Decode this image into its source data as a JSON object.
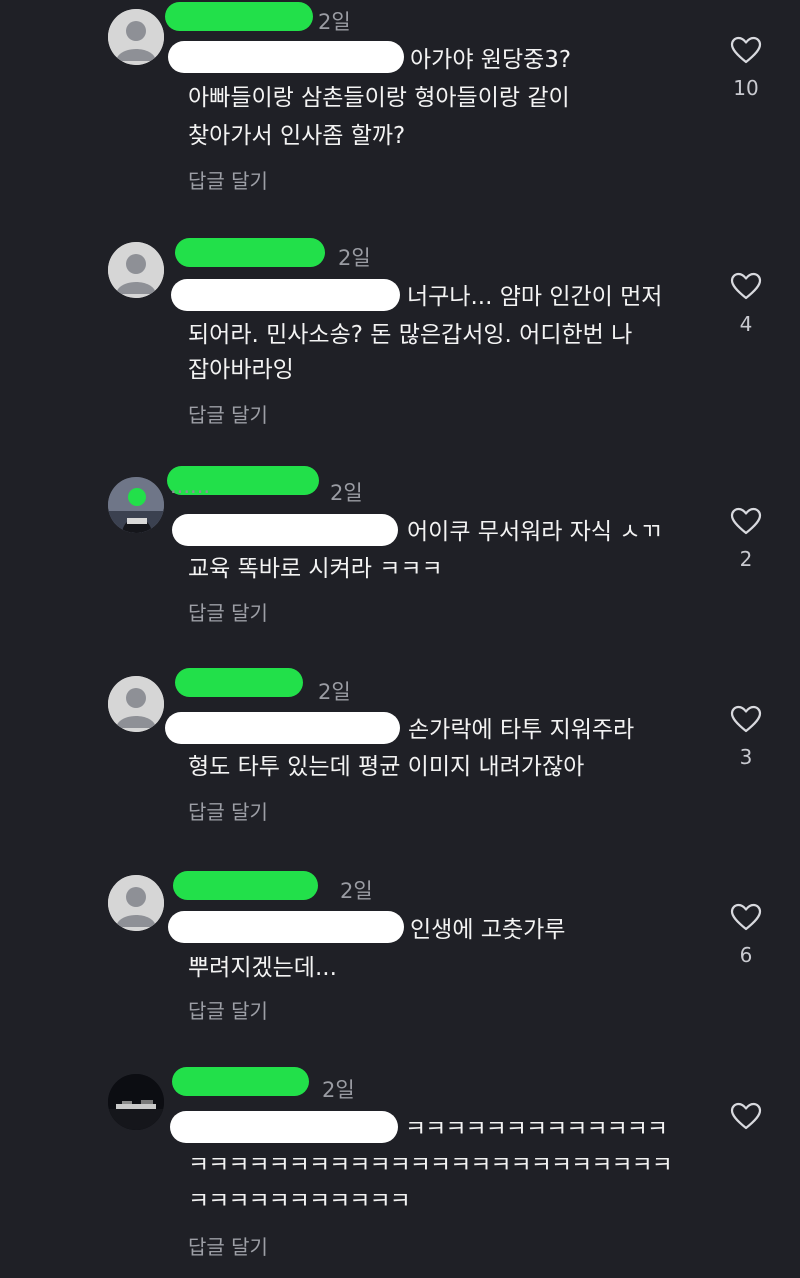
{
  "colors": {
    "background": "#1f2026",
    "username_redaction": "#22e04a",
    "mention_redaction": "#ffffff",
    "meta_text": "#9a9ca3"
  },
  "icons": {
    "like": "heart-outline-icon",
    "avatar_default": "default-profile-icon"
  },
  "comments": [
    {
      "time": "2일",
      "lines": [
        "아가야 원당중3?",
        "아빠들이랑 삼촌들이랑 형아들이랑 같이",
        "찾아가서 인사좀 할까?"
      ],
      "reply_label": "답글 달기",
      "likes": "10"
    },
    {
      "time": "2일",
      "lines": [
        "너구나... 얌마 인간이 먼저",
        "되어라. 민사소송? 돈 많은갑서잉. 어디한번 나",
        "잡아바라잉"
      ],
      "reply_label": "답글 달기",
      "likes": "4"
    },
    {
      "time": "2일",
      "lines": [
        "어이쿠 무서워라 자식 ㅅㄲ",
        "교육 똑바로 시켜라 ㅋㅋㅋ"
      ],
      "reply_label": "답글 달기",
      "likes": "2"
    },
    {
      "time": "2일",
      "lines": [
        "손가락에 타투 지워주라",
        "형도 타투 있는데 평균 이미지 내려가잖아"
      ],
      "reply_label": "답글 달기",
      "likes": "3"
    },
    {
      "time": "2일",
      "lines": [
        "인생에 고춧가루",
        "뿌려지겠는데..."
      ],
      "reply_label": "답글 달기",
      "likes": "6"
    },
    {
      "time": "2일",
      "lines": [
        "ㅋㅋㅋㅋㅋㅋㅋㅋㅋㅋㅋㅋㅋ",
        "ㅋㅋㅋㅋㅋㅋㅋㅋㅋㅋㅋㅋㅋㅋㅋㅋㅋㅋㅋㅋㅋㅋㅋㅋ",
        "ㅋㅋㅋㅋㅋㅋㅋㅋㅋㅋㅋ"
      ],
      "reply_label": "답글 달기",
      "likes": ""
    }
  ]
}
